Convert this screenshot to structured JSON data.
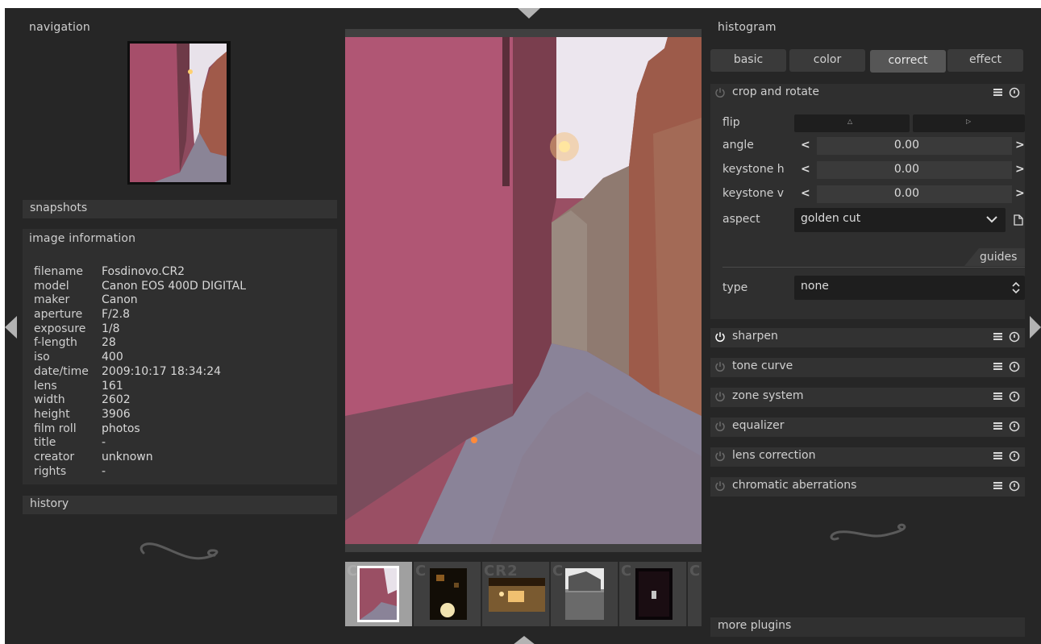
{
  "left_panel": {
    "navigation_title": "navigation",
    "snapshots_title": "snapshots",
    "image_info_title": "image information",
    "history_title": "history",
    "image_info": [
      {
        "key": "filename",
        "value": "Fosdinovo.CR2"
      },
      {
        "key": "model",
        "value": "Canon EOS 400D DIGITAL"
      },
      {
        "key": "maker",
        "value": "Canon"
      },
      {
        "key": "aperture",
        "value": "F/2.8"
      },
      {
        "key": "exposure",
        "value": "1/8"
      },
      {
        "key": "f-length",
        "value": "28"
      },
      {
        "key": "iso",
        "value": "400"
      },
      {
        "key": "date/time",
        "value": "2009:10:17 18:34:24"
      },
      {
        "key": "lens",
        "value": "161"
      },
      {
        "key": "width",
        "value": "2602"
      },
      {
        "key": "height",
        "value": "3906"
      },
      {
        "key": "film roll",
        "value": "photos"
      },
      {
        "key": "title",
        "value": "-"
      },
      {
        "key": "creator",
        "value": "unknown"
      },
      {
        "key": "rights",
        "value": "-"
      }
    ]
  },
  "filmstrip": [
    {
      "ext": "C",
      "selected": true
    },
    {
      "ext": "C",
      "selected": false
    },
    {
      "ext": "CR2",
      "selected": false
    },
    {
      "ext": "C",
      "selected": false
    },
    {
      "ext": "C",
      "selected": false
    },
    {
      "ext": "C",
      "selected": false
    }
  ],
  "right_panel": {
    "histogram_title": "histogram",
    "tabs": [
      {
        "label": "basic",
        "active": false
      },
      {
        "label": "color",
        "active": false
      },
      {
        "label": "correct",
        "active": true
      },
      {
        "label": "effect",
        "active": false
      }
    ],
    "crop": {
      "name": "crop and rotate",
      "flip_label": "flip",
      "angle_label": "angle",
      "angle_value": "0.00",
      "keystone_h_label": "keystone h",
      "keystone_h_value": "0.00",
      "keystone_v_label": "keystone v",
      "keystone_v_value": "0.00",
      "aspect_label": "aspect",
      "aspect_value": "golden cut",
      "guides_label": "guides",
      "type_label": "type",
      "type_value": "none",
      "chev_left": "<",
      "chev_right": ">"
    },
    "modules": [
      {
        "name": "sharpen",
        "enabled": true
      },
      {
        "name": "tone curve",
        "enabled": false
      },
      {
        "name": "zone system",
        "enabled": false
      },
      {
        "name": "equalizer",
        "enabled": false
      },
      {
        "name": "lens correction",
        "enabled": false
      },
      {
        "name": "chromatic aberrations",
        "enabled": false
      }
    ],
    "more_plugins": "more plugins"
  },
  "colors": {
    "background": "#262626",
    "panel": "#2f2f2f",
    "text": "#cfcfcf",
    "active_tab": "#565656"
  }
}
